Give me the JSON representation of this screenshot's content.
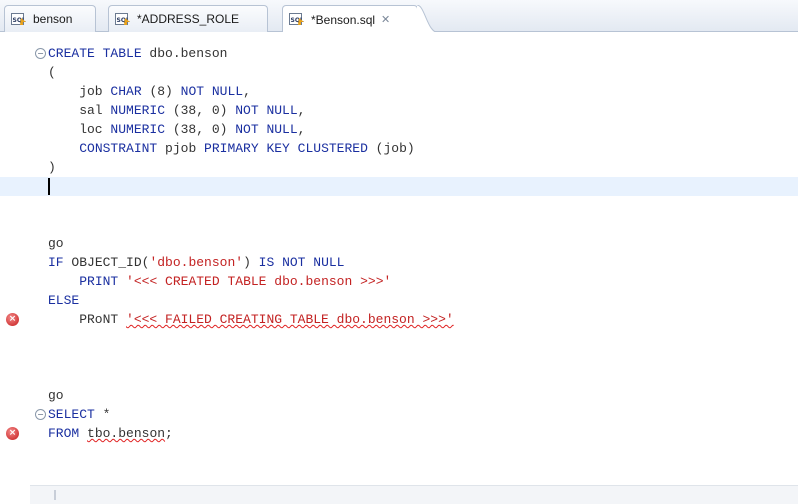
{
  "tabs": [
    {
      "label": "benson",
      "active": false,
      "closable": false
    },
    {
      "label": "*ADDRESS_ROLE",
      "active": false,
      "closable": false
    },
    {
      "label": "*Benson.sql",
      "active": true,
      "closable": true,
      "close_glyph": "✕"
    }
  ],
  "icons": {
    "sql_file": "sql-file-icon",
    "error": "error-marker-icon",
    "fold": "fold-collapse-icon"
  },
  "colors": {
    "keyword": "#1a2fa0",
    "string": "#c32222",
    "error": "#e02020",
    "current_line": "#e8f2fe"
  },
  "editor": {
    "lines": [
      {
        "fold": true,
        "parts": [
          {
            "t": "kw",
            "v": "CREATE TABLE"
          },
          {
            "t": "plain",
            "v": " dbo.benson"
          }
        ]
      },
      {
        "parts": [
          {
            "t": "plain",
            "v": "("
          }
        ]
      },
      {
        "parts": [
          {
            "t": "plain",
            "v": "    job "
          },
          {
            "t": "kw",
            "v": "CHAR"
          },
          {
            "t": "plain",
            "v": " (8) "
          },
          {
            "t": "kw",
            "v": "NOT NULL"
          },
          {
            "t": "plain",
            "v": ","
          }
        ]
      },
      {
        "parts": [
          {
            "t": "plain",
            "v": "    sal "
          },
          {
            "t": "kw",
            "v": "NUMERIC"
          },
          {
            "t": "plain",
            "v": " (38, 0) "
          },
          {
            "t": "kw",
            "v": "NOT NULL"
          },
          {
            "t": "plain",
            "v": ","
          }
        ]
      },
      {
        "parts": [
          {
            "t": "plain",
            "v": "    loc "
          },
          {
            "t": "kw",
            "v": "NUMERIC"
          },
          {
            "t": "plain",
            "v": " (38, 0) "
          },
          {
            "t": "kw",
            "v": "NOT NULL"
          },
          {
            "t": "plain",
            "v": ","
          }
        ]
      },
      {
        "parts": [
          {
            "t": "plain",
            "v": "    "
          },
          {
            "t": "kw",
            "v": "CONSTRAINT"
          },
          {
            "t": "plain",
            "v": " pjob "
          },
          {
            "t": "kw",
            "v": "PRIMARY KEY CLUSTERED"
          },
          {
            "t": "plain",
            "v": " (job)"
          }
        ]
      },
      {
        "parts": [
          {
            "t": "plain",
            "v": ")"
          }
        ]
      },
      {
        "current": true,
        "parts": []
      },
      {
        "parts": []
      },
      {
        "parts": []
      },
      {
        "parts": [
          {
            "t": "plain",
            "v": "go"
          }
        ]
      },
      {
        "parts": [
          {
            "t": "kw",
            "v": "IF"
          },
          {
            "t": "plain",
            "v": " OBJECT_ID("
          },
          {
            "t": "str",
            "v": "'dbo.benson'"
          },
          {
            "t": "plain",
            "v": ") "
          },
          {
            "t": "kw",
            "v": "IS NOT NULL"
          }
        ]
      },
      {
        "parts": [
          {
            "t": "plain",
            "v": "    "
          },
          {
            "t": "kw",
            "v": "PRINT"
          },
          {
            "t": "plain",
            "v": " "
          },
          {
            "t": "str",
            "v": "'<<< CREATED TABLE dbo.benson >>>'"
          }
        ]
      },
      {
        "parts": [
          {
            "t": "kw",
            "v": "ELSE"
          }
        ]
      },
      {
        "error": true,
        "parts": [
          {
            "t": "plain",
            "v": "    PRoNT "
          },
          {
            "t": "str",
            "v": "'<<< FAILED CREATING TABLE dbo.benson >>>'",
            "squiggle": true
          }
        ]
      },
      {
        "parts": []
      },
      {
        "parts": []
      },
      {
        "parts": []
      },
      {
        "parts": [
          {
            "t": "plain",
            "v": "go"
          }
        ]
      },
      {
        "fold": true,
        "parts": [
          {
            "t": "kw",
            "v": "SELECT"
          },
          {
            "t": "plain",
            "v": " *"
          }
        ]
      },
      {
        "error": true,
        "parts": [
          {
            "t": "kw",
            "v": "FROM"
          },
          {
            "t": "plain",
            "v": " "
          },
          {
            "t": "plain",
            "v": "tbo.benson",
            "squiggle": true
          },
          {
            "t": "plain",
            "v": ";"
          }
        ]
      }
    ]
  }
}
